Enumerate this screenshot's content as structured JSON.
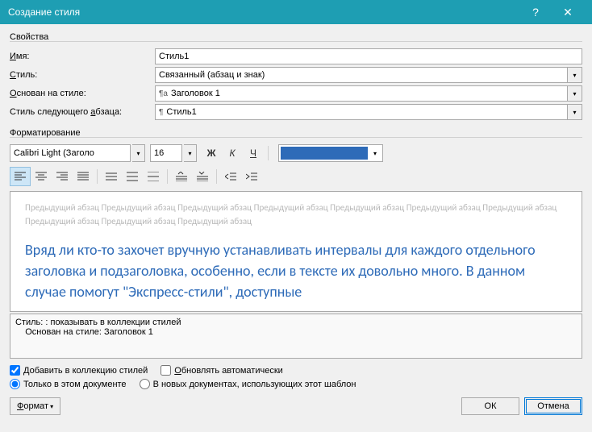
{
  "titlebar": {
    "title": "Создание стиля"
  },
  "properties": {
    "group": "Свойства",
    "name_label_pre": "",
    "name_label_u": "И",
    "name_label_post": "мя:",
    "name_value": "Стиль1",
    "type_label_pre": "",
    "type_label_u": "С",
    "type_label_post": "тиль:",
    "type_value": "Связанный (абзац и знак)",
    "based_label_pre": "",
    "based_label_u": "О",
    "based_label_post": "снован на стиле:",
    "based_value": "Заголовок 1",
    "next_label_pre": "Стиль следующего ",
    "next_label_u": "а",
    "next_label_post": "бзаца:",
    "next_value": "Стиль1"
  },
  "formatting": {
    "group": "Форматирование",
    "font": "Calibri Light (Заголо",
    "size": "16",
    "color": "#2e6bb8"
  },
  "preview": {
    "prev_text": "Предыдущий абзац Предыдущий абзац Предыдущий абзац Предыдущий абзац Предыдущий абзац Предыдущий абзац Предыдущий абзац Предыдущий абзац Предыдущий абзац Предыдущий абзац",
    "sample_text": "Вряд ли кто-то захочет вручную устанавливать интервалы для каждого отдельного заголовка и подзаголовка, особенно, если в тексте их довольно много. В данном случае помогут \"Экспресс-стили\", доступные"
  },
  "description": {
    "line1": "Стиль: : показывать в коллекции стилей",
    "line2": "    Основан на стиле: Заголовок 1"
  },
  "options": {
    "add_collection": "Добавить в коллекцию стилей",
    "auto_update": "Обновлять автоматически",
    "only_doc": "Только в этом документе",
    "new_docs": "В новых документах, использующих этот шаблон"
  },
  "buttons": {
    "format": "Формат",
    "ok": "ОК",
    "cancel": "Отмена"
  }
}
